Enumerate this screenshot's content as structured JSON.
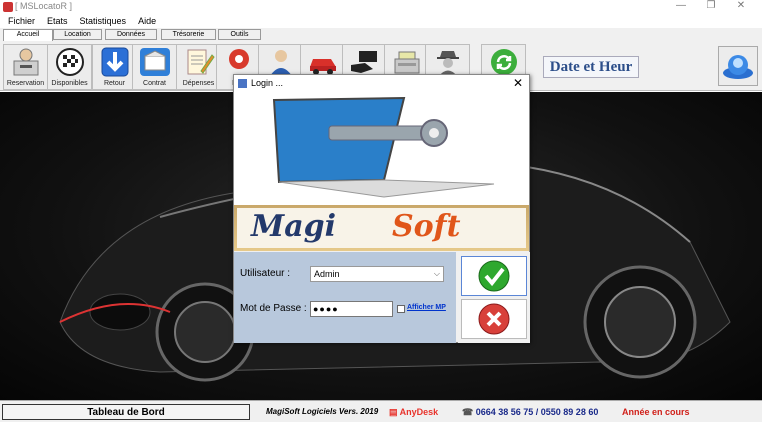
{
  "window": {
    "title": "[ MSLocatoR ]"
  },
  "menu": [
    "Fichier",
    "Etats",
    "Statistiques",
    "Aide"
  ],
  "tabs": [
    "Accueil",
    "Location",
    "Données",
    "Trésorerie",
    "Outils"
  ],
  "toolbar": {
    "buttons": [
      {
        "label": "Reservation",
        "icon": "reservation-icon"
      },
      {
        "label": "Disponibles",
        "icon": "checkered-flag-icon"
      },
      {
        "label": "Retour",
        "icon": "arrow-down-icon"
      },
      {
        "label": "Contrat",
        "icon": "contract-box-icon"
      },
      {
        "label": "Dépenses",
        "icon": "notepad-pen-icon"
      },
      {
        "label": "Entr",
        "icon": "mechanic-icon"
      },
      {
        "label": "",
        "icon": "person-icon"
      },
      {
        "label": "",
        "icon": "car-icon"
      },
      {
        "label": "",
        "icon": "hand-card-icon"
      },
      {
        "label": "",
        "icon": "cash-register-icon"
      },
      {
        "label": "",
        "icon": "spy-icon"
      },
      {
        "label": "",
        "icon": "refresh-icon"
      }
    ],
    "date_heure": "Date et Heur"
  },
  "login": {
    "title": "Login ...",
    "brand_left": "Magi",
    "brand_right": "Soft",
    "user_label": "Utilisateur :",
    "user_value": "Admin",
    "password_label": "Mot de Passe :",
    "password_value": "●●●●",
    "show_password_label": "Afficher MP"
  },
  "statusbar": {
    "tableau": "Tableau de Bord",
    "version": "MagiSoft Logiciels Vers. 2019",
    "anydesk": "AnyDesk",
    "phone": "0664 38 56 75 / 0550 89 28 60",
    "annee": "Année en cours"
  },
  "colors": {
    "accent_blue": "#2c4e8a",
    "brand_orange": "#e0561a",
    "status_red": "#d0201a",
    "form_bg": "#b8c8dc"
  }
}
